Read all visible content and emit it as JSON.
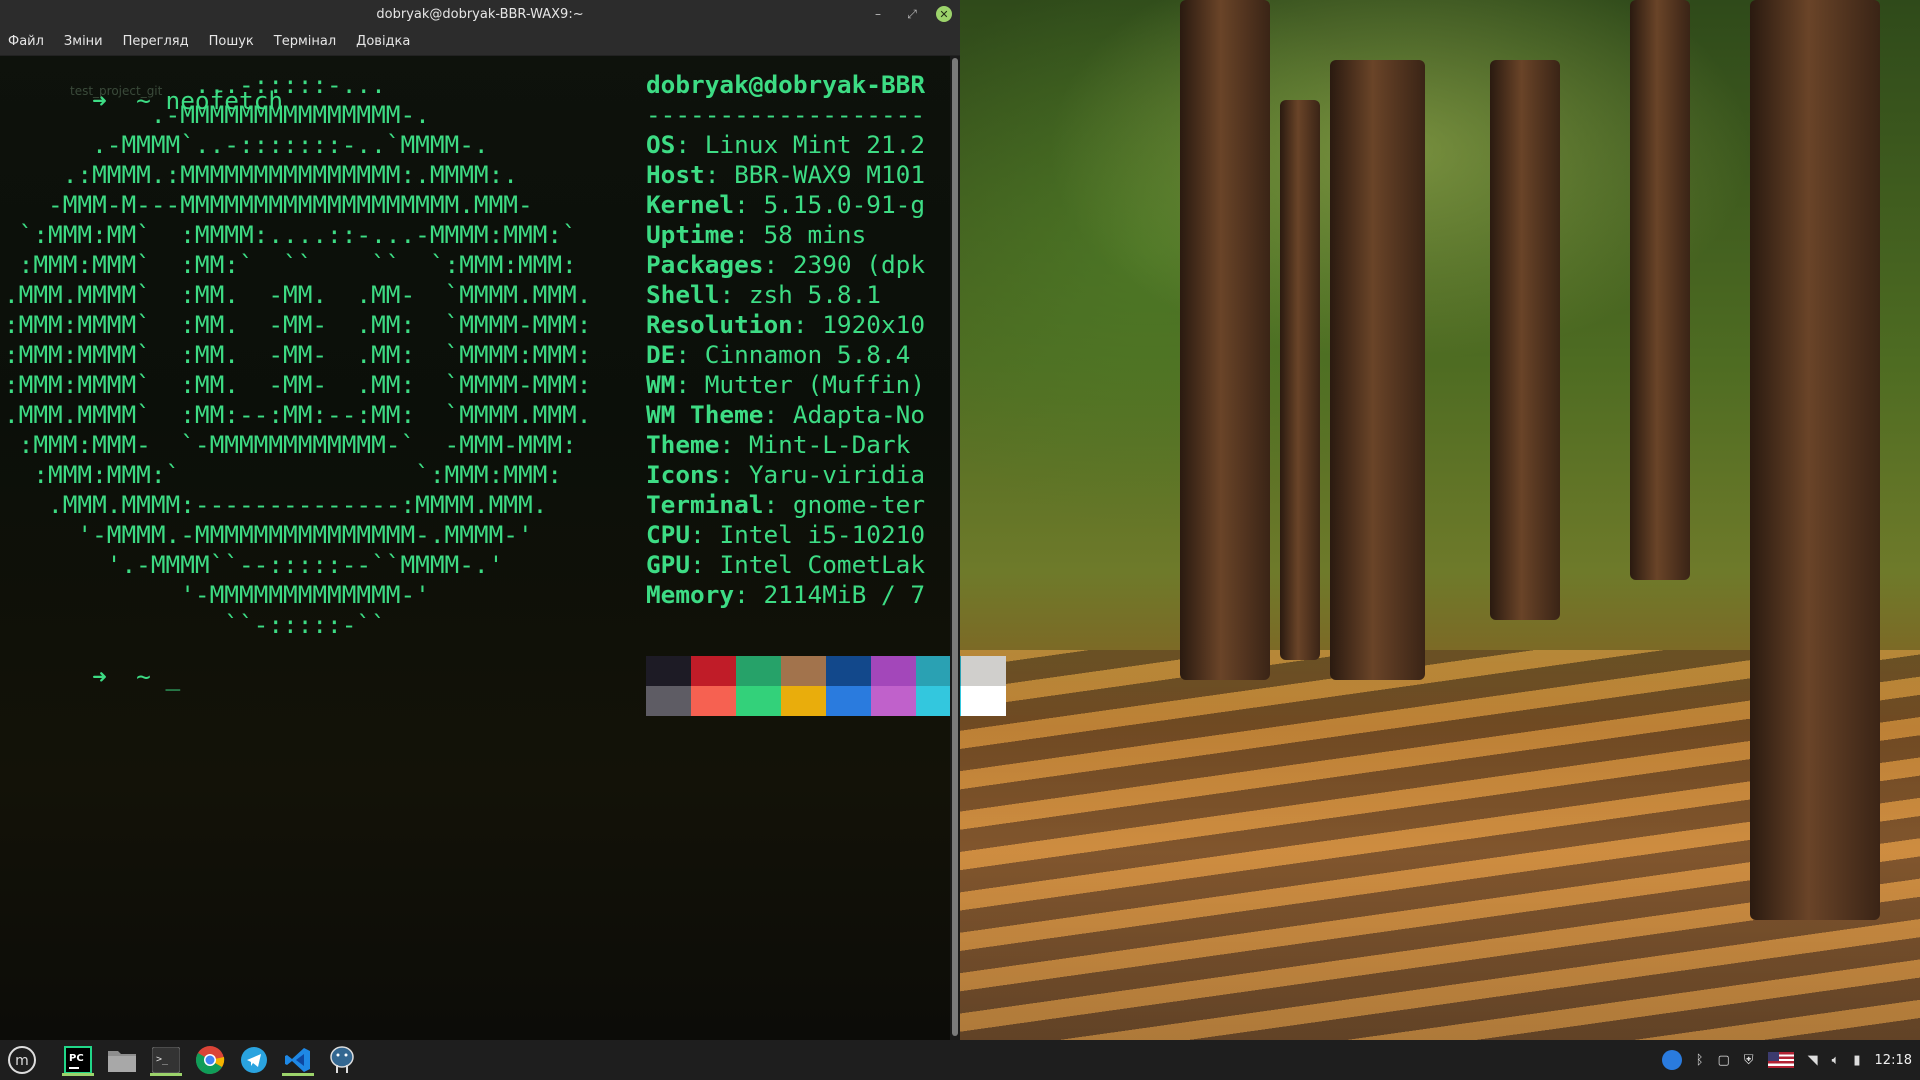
{
  "window": {
    "title": "dobryak@dobryak-BBR-WAX9:~",
    "controls": {
      "minimize": "–",
      "maximize": "⤢",
      "close": "✕"
    }
  },
  "menu": [
    "Файл",
    "Зміни",
    "Перегляд",
    "Пошук",
    "Термінал",
    "Довідка"
  ],
  "terminal": {
    "prompt_arrow": "➜",
    "prompt_dir": "~",
    "command": "neofetch",
    "hint": "test_project_git",
    "second_prompt_cursor": "_",
    "ascii_logo": [
      "             ...-:::::-...",
      "          .-MMMMMMMMMMMMMMM-.",
      "      .-MMMM`..-:::::::-..`MMMM-.",
      "    .:MMMM.:MMMMMMMMMMMMMMM:.MMMM:.",
      "   -MMM-M---MMMMMMMMMMMMMMMMMMM.MMM-",
      " `:MMM:MM`  :MMMM:....::-...-MMMM:MMM:`",
      " :MMM:MMM`  :MM:`  ``    ``  `:MMM:MMM:",
      ".MMM.MMMM`  :MM.  -MM.  .MM-  `MMMM.MMM.",
      ":MMM:MMMM`  :MM.  -MM-  .MM:  `MMMM-MMM:",
      ":MMM:MMMM`  :MM.  -MM-  .MM:  `MMMM:MMM:",
      ":MMM:MMMM`  :MM.  -MM-  .MM:  `MMMM-MMM:",
      ".MMM.MMMM`  :MM:--:MM:--:MM:  `MMMM.MMM.",
      " :MMM:MMM-  `-MMMMMMMMMMMM-`  -MMM-MMM:",
      "  :MMM:MMM:`                `:MMM:MMM:",
      "   .MMM.MMMM:--------------:MMMM.MMM.",
      "     '-MMMM.-MMMMMMMMMMMMMMM-.MMMM-'",
      "       '.-MMMM``--:::::--``MMMM-.'",
      "            '-MMMMMMMMMMMMM-'",
      "               ``-:::::-``"
    ],
    "info": {
      "user_host": "dobryak@dobryak-BBR",
      "separator": "-------------------",
      "rows": [
        {
          "key": "OS",
          "value": "Linux Mint 21.2"
        },
        {
          "key": "Host",
          "value": "BBR-WAX9 M101"
        },
        {
          "key": "Kernel",
          "value": "5.15.0-91-g"
        },
        {
          "key": "Uptime",
          "value": "58 mins"
        },
        {
          "key": "Packages",
          "value": "2390 (dpk"
        },
        {
          "key": "Shell",
          "value": "zsh 5.8.1"
        },
        {
          "key": "Resolution",
          "value": "1920x10"
        },
        {
          "key": "DE",
          "value": "Cinnamon 5.8.4"
        },
        {
          "key": "WM",
          "value": "Mutter (Muffin)"
        },
        {
          "key": "WM Theme",
          "value": "Adapta-No"
        },
        {
          "key": "Theme",
          "value": "Mint-L-Dark"
        },
        {
          "key": "Icons",
          "value": "Yaru-viridia"
        },
        {
          "key": "Terminal",
          "value": "gnome-ter"
        },
        {
          "key": "CPU",
          "value": "Intel i5-10210"
        },
        {
          "key": "GPU",
          "value": "Intel CometLak"
        },
        {
          "key": "Memory",
          "value": "2114MiB / 7"
        }
      ]
    },
    "palette": {
      "normal": [
        "#1d1b25",
        "#c01c28",
        "#26a269",
        "#a2734c",
        "#12488b",
        "#a347ba",
        "#2aa1b3",
        "#d0cfcc"
      ],
      "bright": [
        "#5e5c64",
        "#f66151",
        "#33d17a",
        "#e9ad0c",
        "#2a7bde",
        "#c061cb",
        "#33c7de",
        "#ffffff"
      ]
    }
  },
  "taskbar": {
    "apps": [
      {
        "name": "menu-icon",
        "label": "m"
      },
      {
        "name": "pycharm-icon",
        "label": "PC"
      },
      {
        "name": "files-icon",
        "label": ""
      },
      {
        "name": "terminal-icon",
        "label": ">_"
      },
      {
        "name": "chrome-icon",
        "label": ""
      },
      {
        "name": "telegram-icon",
        "label": ""
      },
      {
        "name": "vscode-icon",
        "label": ""
      },
      {
        "name": "postgres-icon",
        "label": ""
      }
    ],
    "clock": "12:18"
  }
}
